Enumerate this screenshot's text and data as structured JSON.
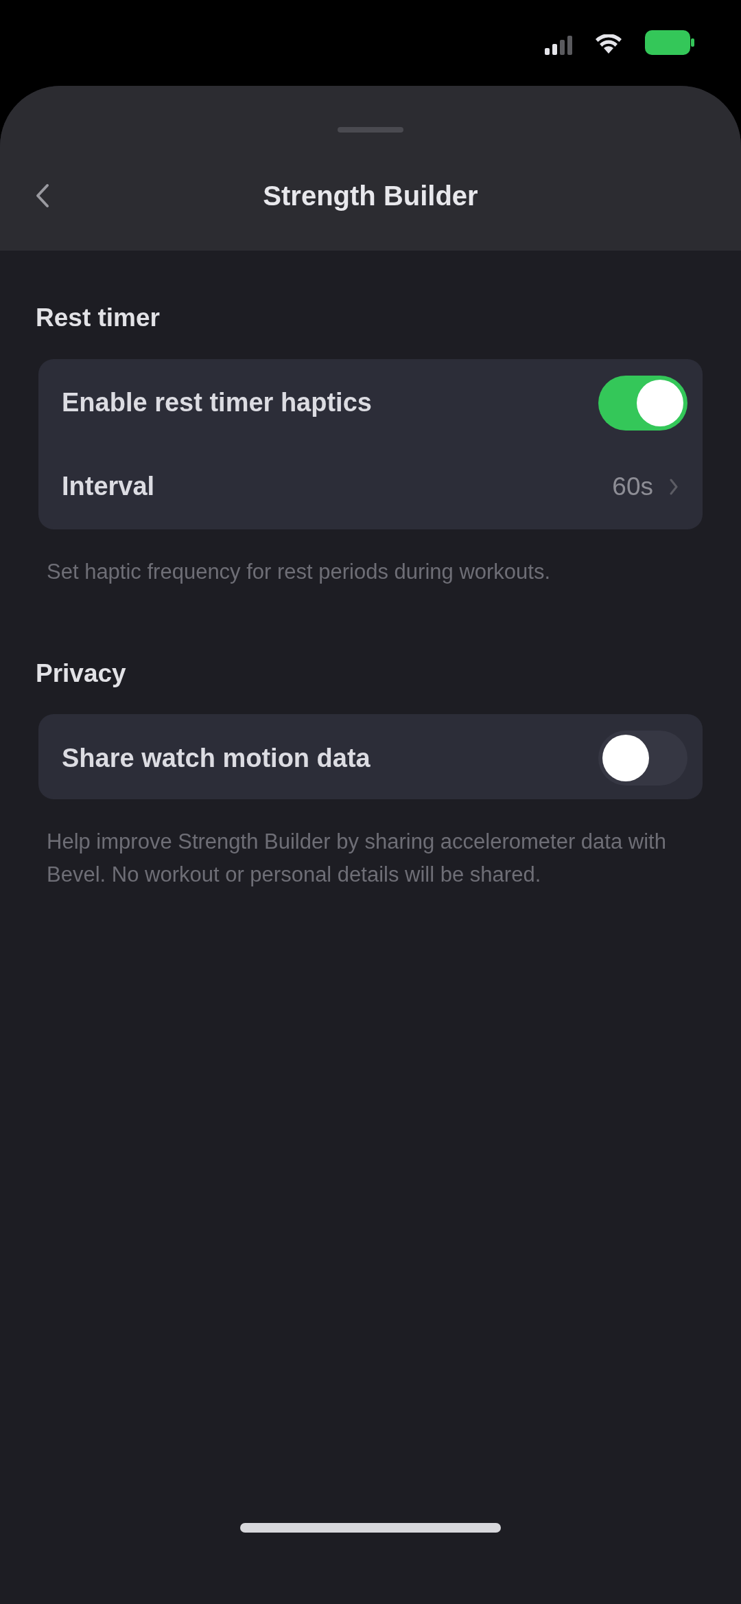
{
  "header": {
    "title": "Strength Builder"
  },
  "sections": [
    {
      "title": "Rest timer",
      "rows": [
        {
          "kind": "toggle",
          "label": "Enable rest timer haptics",
          "on": true
        },
        {
          "kind": "disclosure",
          "label": "Interval",
          "value": "60s"
        }
      ],
      "footer": "Set haptic frequency for rest periods during workouts."
    },
    {
      "title": "Privacy",
      "rows": [
        {
          "kind": "toggle",
          "label": "Share watch motion data",
          "on": false
        }
      ],
      "footer": "Help improve Strength Builder by sharing accelerometer data with Bevel. No workout or personal details will be shared."
    }
  ]
}
